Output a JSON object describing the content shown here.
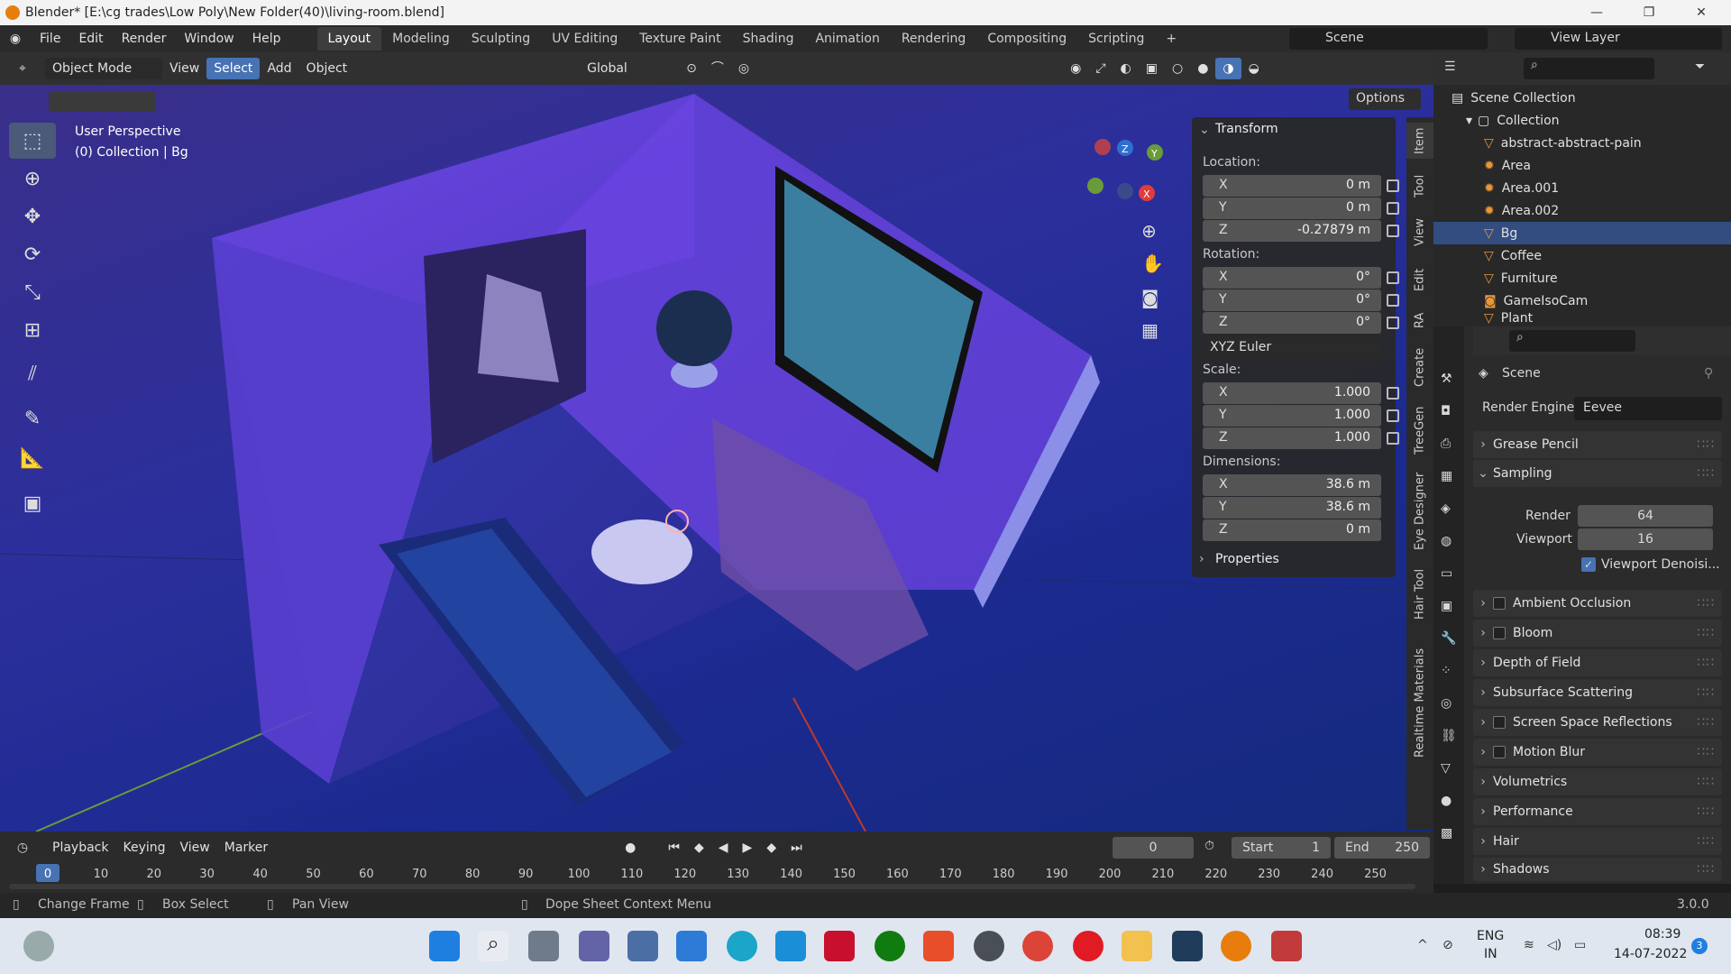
{
  "window": {
    "title": "Blender* [E:\\cg trades\\Low Poly\\New Folder(40)\\living-room.blend]"
  },
  "menu": {
    "items": [
      "File",
      "Edit",
      "Render",
      "Window",
      "Help"
    ]
  },
  "workspaces": [
    "Layout",
    "Modeling",
    "Sculpting",
    "UV Editing",
    "Texture Paint",
    "Shading",
    "Animation",
    "Rendering",
    "Compositing",
    "Scripting"
  ],
  "scene_field": "Scene",
  "view_layer_field": "View Layer",
  "header3d": {
    "mode": "Object Mode",
    "view": "View",
    "select": "Select",
    "add": "Add",
    "object": "Object",
    "orientation": "Global",
    "options": "Options"
  },
  "viewport": {
    "perspective": "User Perspective",
    "collection": "(0) Collection | Bg"
  },
  "npanel": {
    "header": "Transform",
    "location_label": "Location:",
    "location": [
      {
        "axis": "X",
        "value": "0 m"
      },
      {
        "axis": "Y",
        "value": "0 m"
      },
      {
        "axis": "Z",
        "value": "-0.27879 m"
      }
    ],
    "rotation_label": "Rotation:",
    "rotation": [
      {
        "axis": "X",
        "value": "0°"
      },
      {
        "axis": "Y",
        "value": "0°"
      },
      {
        "axis": "Z",
        "value": "0°"
      }
    ],
    "rotation_mode": "XYZ Euler",
    "scale_label": "Scale:",
    "scale": [
      {
        "axis": "X",
        "value": "1.000"
      },
      {
        "axis": "Y",
        "value": "1.000"
      },
      {
        "axis": "Z",
        "value": "1.000"
      }
    ],
    "dimensions_label": "Dimensions:",
    "dimensions": [
      {
        "axis": "X",
        "value": "38.6 m"
      },
      {
        "axis": "Y",
        "value": "38.6 m"
      },
      {
        "axis": "Z",
        "value": "0 m"
      }
    ],
    "properties": "Properties"
  },
  "side_tabs": [
    "Item",
    "Tool",
    "View",
    "Edit",
    "RA",
    "Create",
    "TreeGen",
    "Eye Designer",
    "Hair Tool",
    "Realtime Materials"
  ],
  "outliner": {
    "root": "Scene Collection",
    "collection": "Collection",
    "items": [
      "abstract-abstract-pain",
      "Area",
      "Area.001",
      "Area.002",
      "Bg",
      "Coffee",
      "Furniture",
      "GameIsoCam",
      "Plant"
    ],
    "selected": "Bg"
  },
  "properties": {
    "scene": "Scene",
    "render_engine_label": "Render Engine",
    "render_engine": "Eevee",
    "sections": [
      "Grease Pencil",
      "Sampling",
      "Ambient Occlusion",
      "Bloom",
      "Depth of Field",
      "Subsurface Scattering",
      "Screen Space Reflections",
      "Motion Blur",
      "Volumetrics",
      "Performance",
      "Hair",
      "Shadows"
    ],
    "render_label": "Render",
    "render_value": "64",
    "viewport_label": "Viewport",
    "viewport_value": "16",
    "viewport_denoise": "Viewport Denoisi..."
  },
  "timeline": {
    "playback": "Playback",
    "keying": "Keying",
    "view": "View",
    "marker": "Marker",
    "frame": "0",
    "start_label": "Start",
    "start": "1",
    "end_label": "End",
    "end": "250",
    "ticks": [
      "0",
      "10",
      "20",
      "30",
      "40",
      "50",
      "60",
      "70",
      "80",
      "90",
      "100",
      "110",
      "120",
      "130",
      "140",
      "150",
      "160",
      "170",
      "180",
      "190",
      "200",
      "210",
      "220",
      "230",
      "240",
      "250"
    ]
  },
  "status": {
    "change_frame": "Change Frame",
    "box_select": "Box Select",
    "pan_view": "Pan View",
    "context_menu": "Dope Sheet Context Menu",
    "version": "3.0.0"
  },
  "taskbar": {
    "lang1": "ENG",
    "lang2": "IN",
    "time": "08:39",
    "date": "14-07-2022",
    "badge": "3"
  }
}
